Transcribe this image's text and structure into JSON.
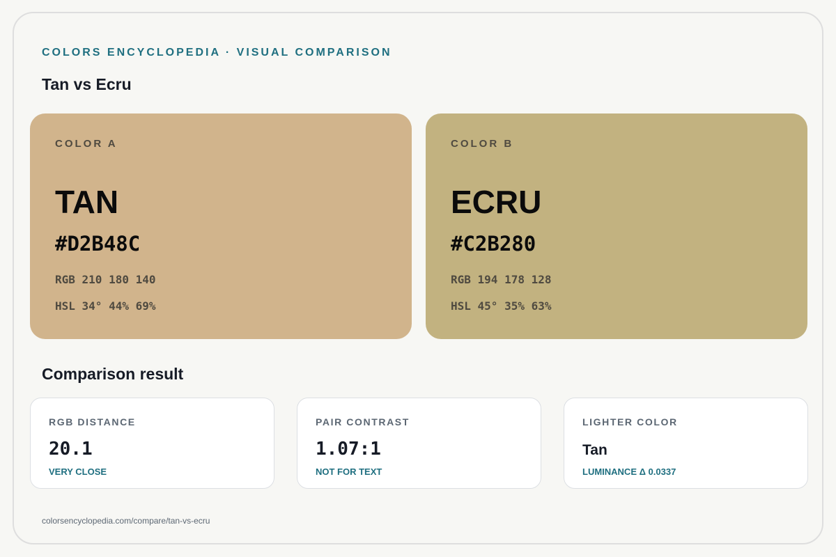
{
  "header": {
    "eyebrow": "COLORS ENCYCLOPEDIA · VISUAL COMPARISON",
    "title": "Tan vs Ecru"
  },
  "colors": [
    {
      "label": "COLOR A",
      "name": "TAN",
      "hex": "#D2B48C",
      "rgb": "RGB 210 180 140",
      "hsl": "HSL 34° 44% 69%",
      "swatch": "#d1b48c"
    },
    {
      "label": "COLOR B",
      "name": "ECRU",
      "hex": "#C2B280",
      "rgb": "RGB 194 178 128",
      "hsl": "HSL 45° 35% 63%",
      "swatch": "#c2b280"
    }
  ],
  "comparison": {
    "title": "Comparison result",
    "stats": [
      {
        "label": "RGB DISTANCE",
        "value": "20.1",
        "note": "VERY CLOSE"
      },
      {
        "label": "PAIR CONTRAST",
        "value": "1.07:1",
        "note": "NOT FOR TEXT"
      },
      {
        "label": "LIGHTER COLOR",
        "value": "Tan",
        "note": "LUMINANCE Δ 0.0337"
      }
    ]
  },
  "footer": {
    "url": "colorsencyclopedia.com/compare/tan-vs-ecru"
  },
  "theme": {
    "accent": "#1f6f80",
    "background": "#f7f7f4"
  }
}
